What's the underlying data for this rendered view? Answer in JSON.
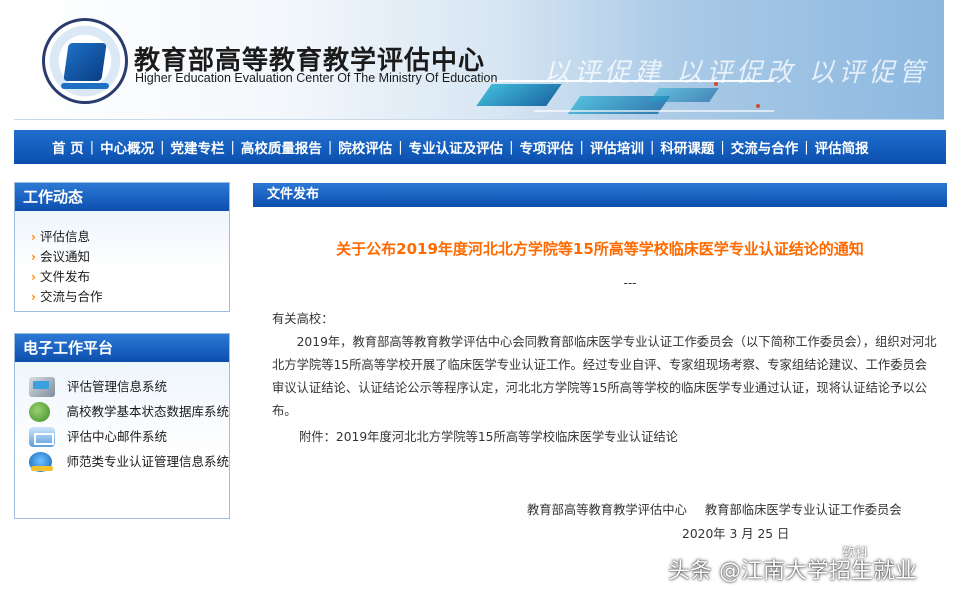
{
  "header": {
    "title_cn": "教育部高等教育教学评估中心",
    "title_en": "Higher Education Evaluation Center Of The Ministry Of Education",
    "slogan": "以评促建  以评促改  以评促管",
    "seal_text": "HIGHER EDUCATION CHINA EVALUATION CENTER 教育部高等教育教学评估中心"
  },
  "nav": {
    "items": [
      "首 页",
      "中心概况",
      "党建专栏",
      "高校质量报告",
      "院校评估",
      "专业认证及评估",
      "专项评估",
      "评估培训",
      "科研课题",
      "交流与合作",
      "评估简报"
    ],
    "separator": "|"
  },
  "sidebar": {
    "work": {
      "title": "工作动态",
      "items": [
        "评估信息",
        "会议通知",
        "文件发布",
        "交流与合作"
      ]
    },
    "platform": {
      "title": "电子工作平台",
      "items": [
        {
          "label": "评估管理信息系统",
          "icon": "computer-icon"
        },
        {
          "label": "高校教学基本状态数据库系统",
          "icon": "globe-icon"
        },
        {
          "label": "评估中心邮件系统",
          "icon": "mail-icon"
        },
        {
          "label": "师范类专业认证管理信息系统",
          "icon": "earth-icon"
        }
      ]
    }
  },
  "main": {
    "section_title": "文件发布",
    "article": {
      "title": "关于公布2019年度河北北方学院等15所高等学校临床医学专业认证结论的通知",
      "dash": "---",
      "greeting": "有关高校：",
      "body": "2019年，教育部高等教育教学评估中心会同教育部临床医学专业认证工作委员会（以下简称工作委员会），组织对河北北方学院等15所高等学校开展了临床医学专业认证工作。经过专业自评、专家组现场考察、专家组结论建议、工作委员会审议认证结论、认证结论公示等程序认定，河北北方学院等15所高等学校的临床医学专业通过认证，现将认证结论予以公布。",
      "attachment": "附件：2019年度河北北方学院等15所高等学校临床医学专业认证结论",
      "sign_org_1": "教育部高等教育教学评估中心",
      "sign_org_2": "教育部临床医学专业认证工作委员会",
      "date": "2020年 3 月 25 日"
    }
  },
  "watermark": {
    "main": "头条 @江南大学招生就业",
    "small": "软科"
  }
}
